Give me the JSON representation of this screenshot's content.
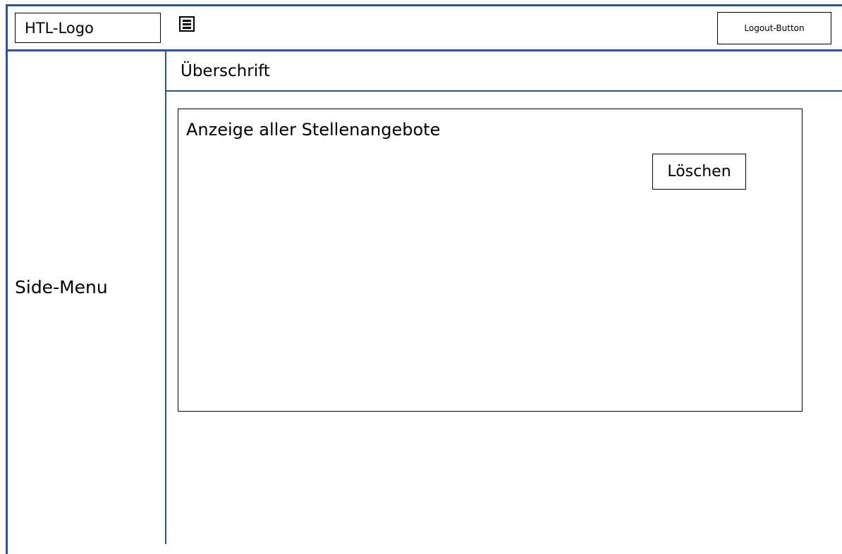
{
  "header": {
    "logo_text": "HTL-Logo",
    "menu_icon": "hamburger-menu-icon",
    "logout_label": "Logout-Button"
  },
  "sidebar": {
    "label": "Side-Menu"
  },
  "main": {
    "heading": "Überschrift",
    "panel": {
      "title": "Anzeige aller Stellenangebote",
      "delete_label": "Löschen"
    }
  },
  "colors": {
    "frame_border": "#2f5597",
    "box_border": "#000000",
    "background": "#ffffff"
  }
}
